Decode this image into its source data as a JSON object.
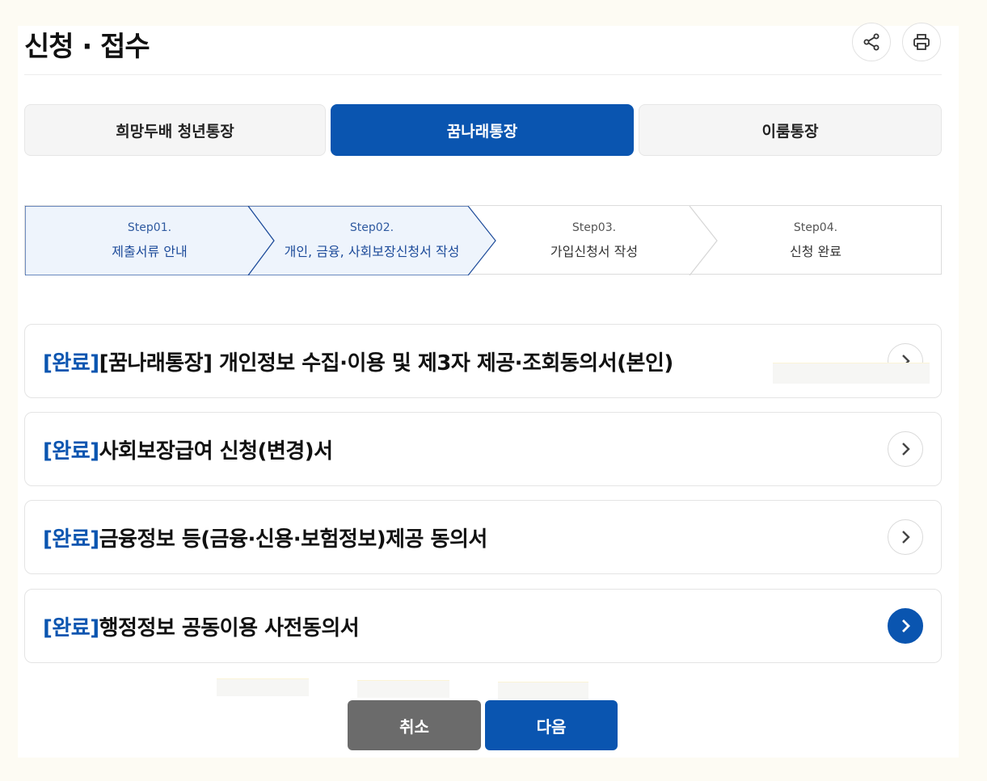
{
  "header": {
    "title": "신청 · 접수",
    "icons": [
      "share-icon",
      "print-icon"
    ]
  },
  "tabs": [
    {
      "label": "희망두배 청년통장",
      "active": false
    },
    {
      "label": "꿈나래통장",
      "active": true
    },
    {
      "label": "이룸통장",
      "active": false
    }
  ],
  "steps": [
    {
      "number": "Step01.",
      "label": "제출서류 안내",
      "done": true
    },
    {
      "number": "Step02.",
      "label": "개인, 금융, 사회보장신청서 작성",
      "done": true
    },
    {
      "number": "Step03.",
      "label": "가입신청서 작성",
      "done": false
    },
    {
      "number": "Step04.",
      "label": "신청 완료",
      "done": false
    }
  ],
  "documents": [
    {
      "status": "[완료]",
      "title": "[꿈나래통장] 개인정보 수집·이용 및 제3자 제공·조회동의서(본인)",
      "icon": "chevron-right-icon"
    },
    {
      "status": "[완료]",
      "title": "사회보장급여 신청(변경)서",
      "icon": "chevron-right-icon"
    },
    {
      "status": "[완료]",
      "title": "금융정보 등(금융·신용·보험정보)제공 동의서",
      "icon": "chevron-right-icon"
    },
    {
      "status": "[완료]",
      "title": "행정정보 공동이용 사전동의서",
      "icon": "chevron-right-icon"
    }
  ],
  "buttons": {
    "cancel": "취소",
    "next": "다음"
  },
  "colors": {
    "primary": "#0a55b0",
    "cancel": "#6b6b6b",
    "step_done_bg": "#eef4fc"
  }
}
